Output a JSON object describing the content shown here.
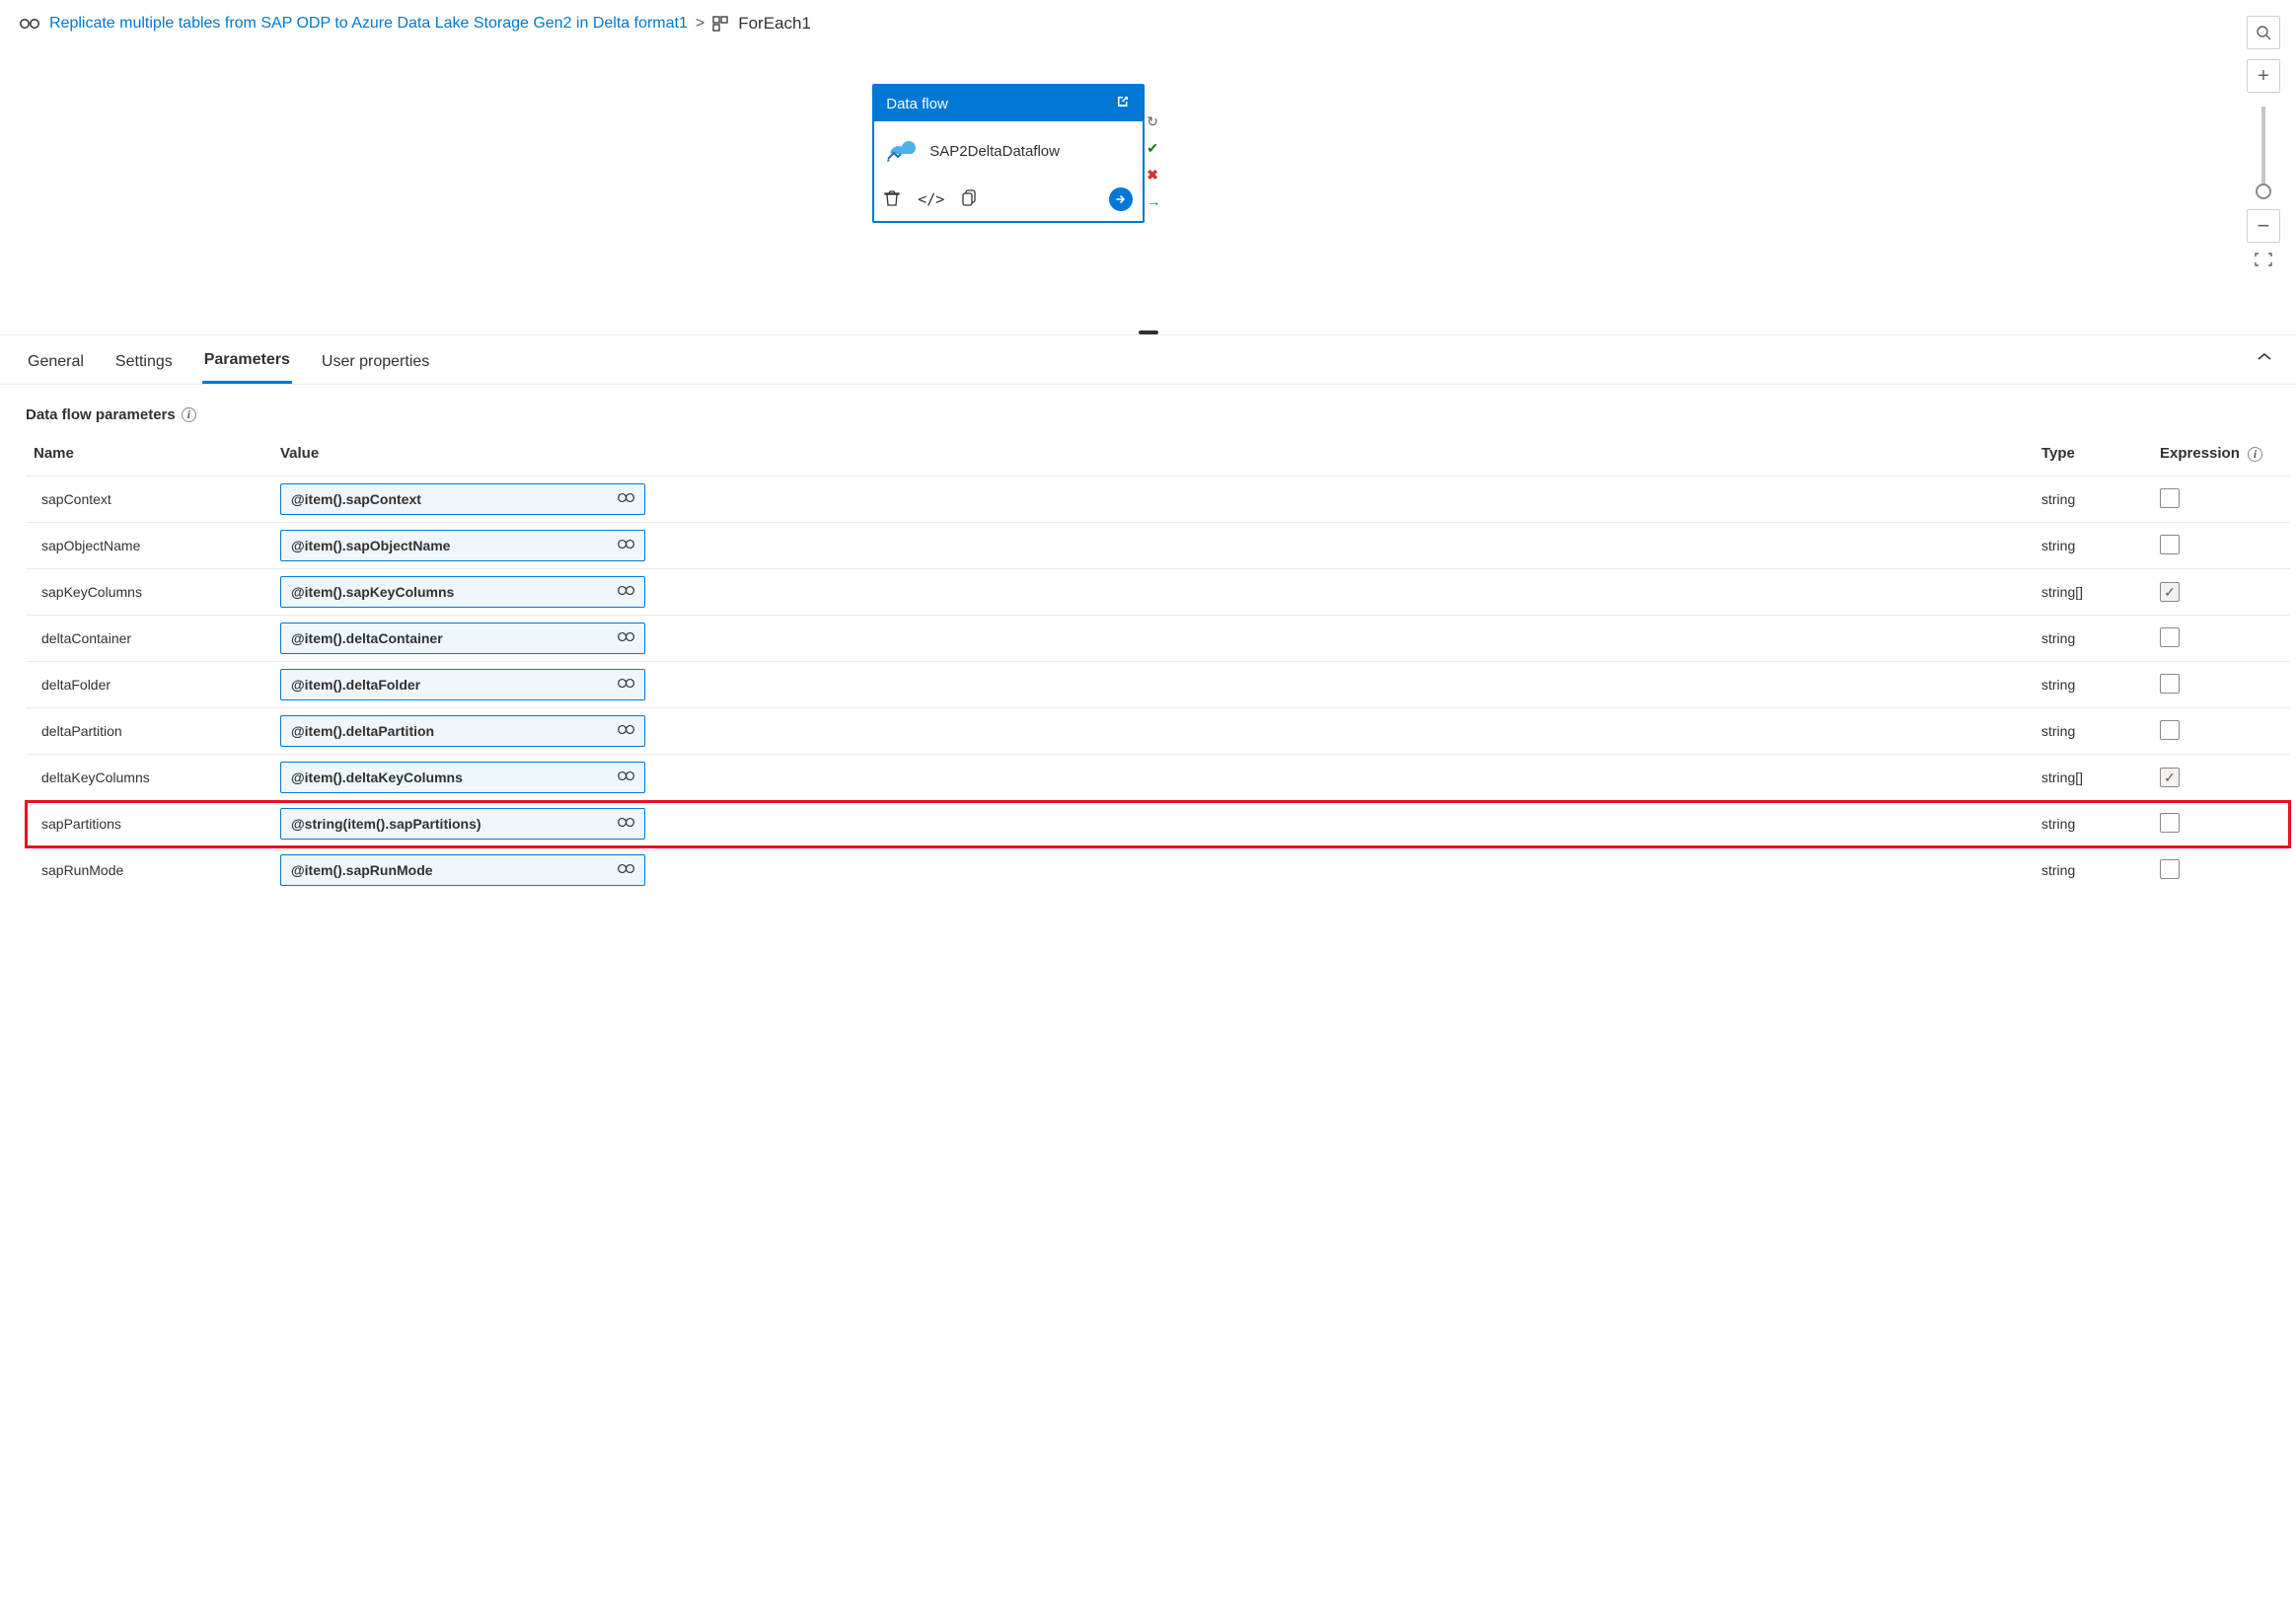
{
  "breadcrumb": {
    "parent": "Replicate multiple tables from SAP ODP to Azure Data Lake Storage Gen2 in Delta format1",
    "current": "ForEach1"
  },
  "activity": {
    "header": "Data flow",
    "name": "SAP2DeltaDataflow"
  },
  "tabs": {
    "general": "General",
    "settings": "Settings",
    "parameters": "Parameters",
    "user_properties": "User properties",
    "active": "Parameters"
  },
  "section": {
    "title": "Data flow parameters"
  },
  "columns": {
    "name": "Name",
    "value": "Value",
    "type": "Type",
    "expression": "Expression"
  },
  "rows": [
    {
      "name": "sapContext",
      "value": "@item().sapContext",
      "type": "string",
      "checked": false,
      "highlight": false
    },
    {
      "name": "sapObjectName",
      "value": "@item().sapObjectName",
      "type": "string",
      "checked": false,
      "highlight": false
    },
    {
      "name": "sapKeyColumns",
      "value": "@item().sapKeyColumns",
      "type": "string[]",
      "checked": true,
      "highlight": false
    },
    {
      "name": "deltaContainer",
      "value": "@item().deltaContainer",
      "type": "string",
      "checked": false,
      "highlight": false
    },
    {
      "name": "deltaFolder",
      "value": "@item().deltaFolder",
      "type": "string",
      "checked": false,
      "highlight": false
    },
    {
      "name": "deltaPartition",
      "value": "@item().deltaPartition",
      "type": "string",
      "checked": false,
      "highlight": false
    },
    {
      "name": "deltaKeyColumns",
      "value": "@item().deltaKeyColumns",
      "type": "string[]",
      "checked": true,
      "highlight": false
    },
    {
      "name": "sapPartitions",
      "value": "@string(item().sapPartitions)",
      "type": "string",
      "checked": false,
      "highlight": true
    },
    {
      "name": "sapRunMode",
      "value": "@item().sapRunMode",
      "type": "string",
      "checked": false,
      "highlight": false
    }
  ]
}
